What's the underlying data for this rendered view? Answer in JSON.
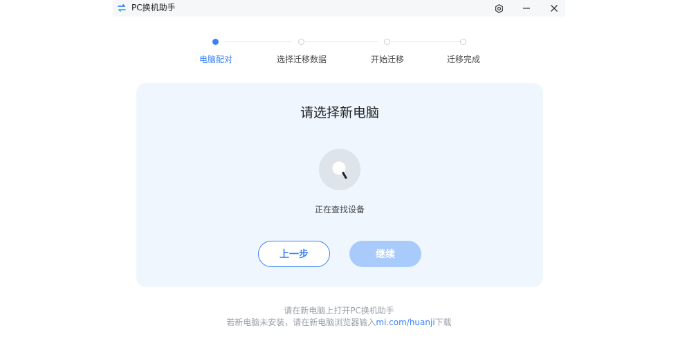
{
  "app": {
    "title": "PC换机助手",
    "accent_color": "#3a82f7"
  },
  "titlebar": {
    "settings_icon": "settings-gear-icon",
    "minimize_icon": "minimize-icon",
    "close_icon": "close-icon"
  },
  "steps": [
    {
      "label": "电脑配对",
      "active": true
    },
    {
      "label": "选择迁移数据",
      "active": false
    },
    {
      "label": "开始迁移",
      "active": false
    },
    {
      "label": "迁移完成",
      "active": false
    }
  ],
  "card": {
    "title": "请选择新电脑",
    "status_text": "正在查找设备",
    "spinner_icon": "search-spinner-icon"
  },
  "buttons": {
    "prev_label": "上一步",
    "next_label": "继续"
  },
  "footer": {
    "line1": "请在新电脑上打开PC换机助手",
    "line2_prefix": "若新电脑未安装，请在新电脑浏览器输入",
    "line2_link": "mi.com/huanji",
    "line2_suffix": "下载"
  }
}
